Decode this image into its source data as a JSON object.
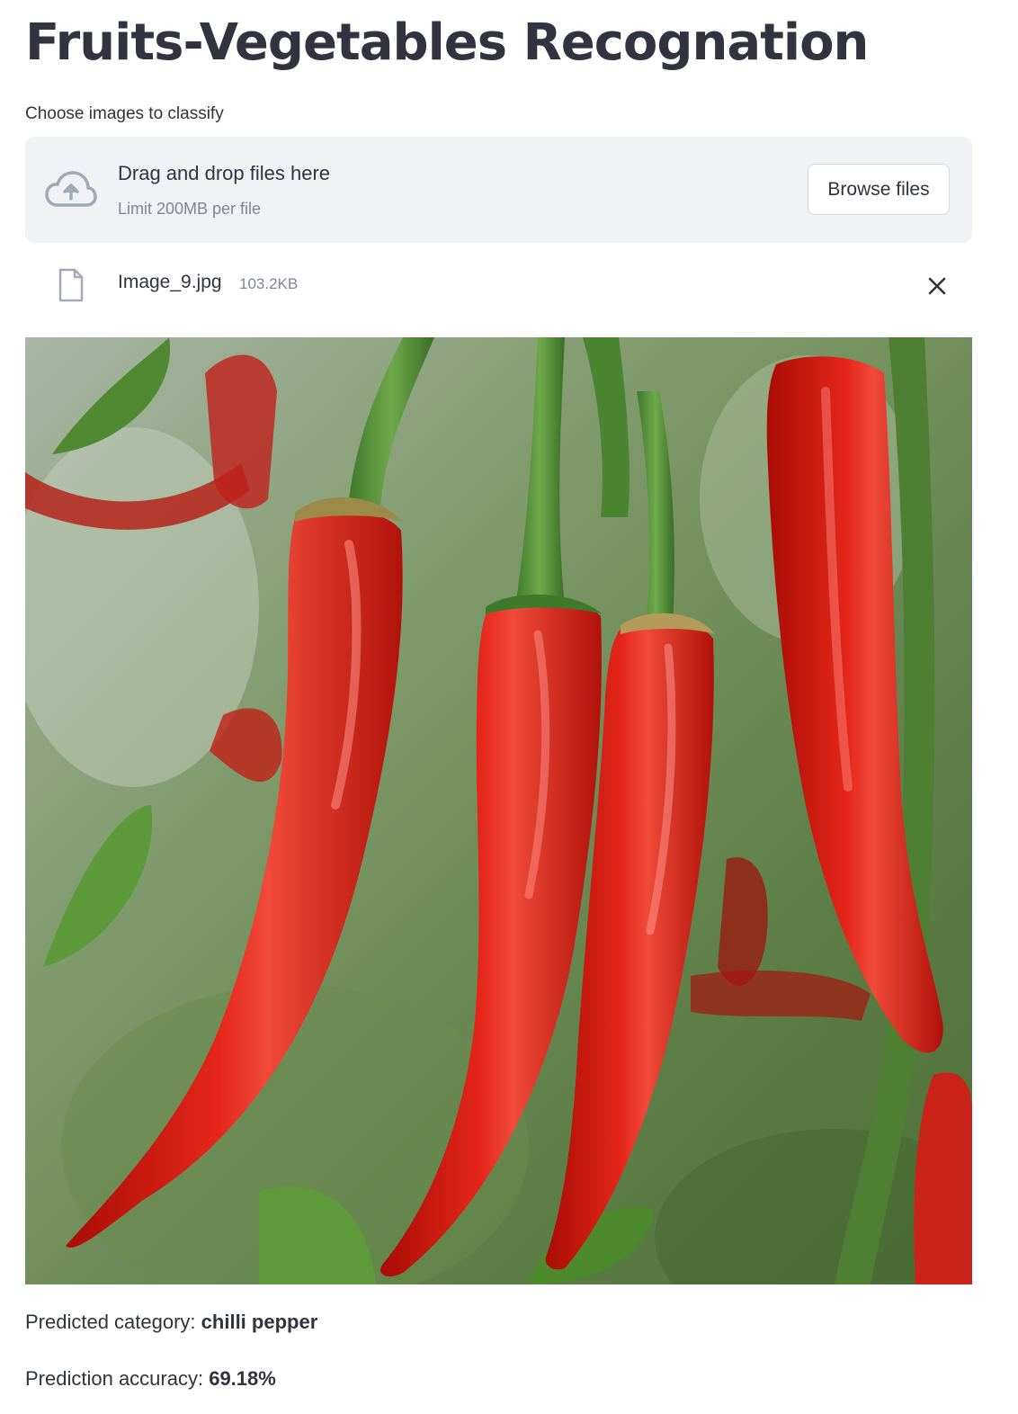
{
  "app": {
    "title": "Fruits-Vegetables Recognation"
  },
  "uploader": {
    "label": "Choose images to classify",
    "drop_text": "Drag and drop files here",
    "limit_text": "Limit 200MB per file",
    "browse_label": "Browse files",
    "icon": "cloud-upload-icon"
  },
  "uploaded_file": {
    "name": "Image_9.jpg",
    "size": "103.2KB",
    "icon": "file-icon",
    "remove_icon": "close-icon"
  },
  "preview": {
    "description_visible": false
  },
  "results": {
    "category_label": "Predicted category: ",
    "category_value": "chilli pepper",
    "accuracy_label": "Prediction accuracy: ",
    "accuracy_value": "69.18%"
  },
  "colors": {
    "text": "#31333f",
    "muted": "#808495",
    "dropzone_bg": "#f0f2f6",
    "icon": "#a3a8b8"
  }
}
